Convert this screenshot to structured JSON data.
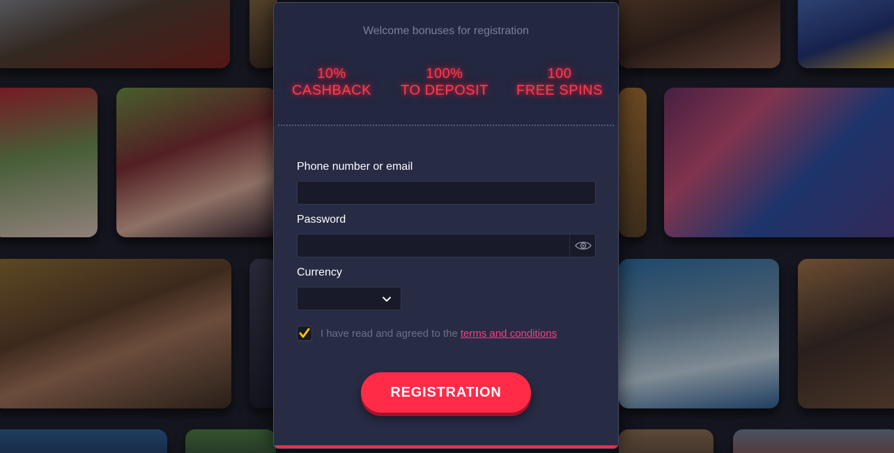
{
  "registration": {
    "welcome_text": "Welcome bonuses for registration",
    "bonuses": [
      {
        "line1": "10%",
        "line2": "CASHBACK"
      },
      {
        "line1": "100%",
        "line2": "TO DEPOSIT"
      },
      {
        "line1": "100",
        "line2": "FREE SPINS"
      }
    ],
    "phone_label": "Phone number or email",
    "phone_value": "",
    "password_label": "Password",
    "password_value": "",
    "currency_label": "Currency",
    "currency_value": "",
    "terms_text": "I have read and agreed to the",
    "terms_link": "terms and conditions",
    "terms_checked": true,
    "submit_label": "REGISTRATION"
  },
  "icons": {
    "password_toggle": "eye-icon",
    "currency_dropdown": "chevron-down-icon",
    "terms_checkbox": "checkmark-icon"
  },
  "colors": {
    "accent": "#ff2b47",
    "neon": "#ff3b4e",
    "link": "#ff3b8a",
    "check": "#f5c400",
    "modal_bg": "#272b44"
  }
}
